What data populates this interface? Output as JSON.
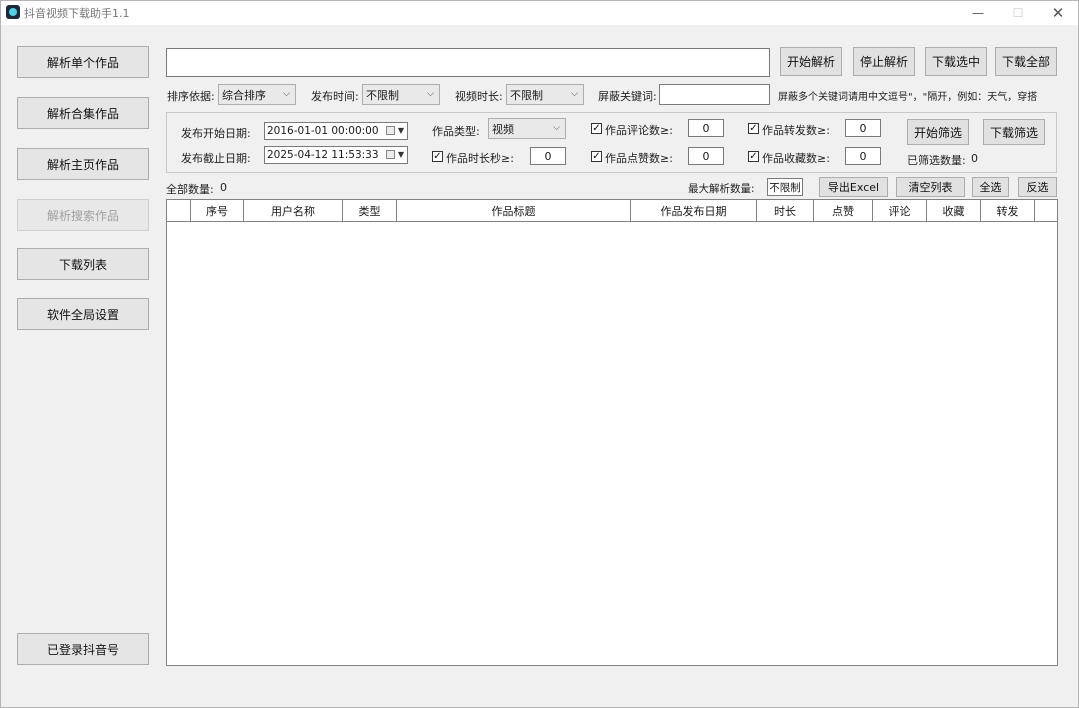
{
  "window": {
    "title": "抖音视频下载助手1.1",
    "min_glyph": "—",
    "max_glyph": "☐",
    "close_glyph": "✕"
  },
  "nav": {
    "parse_single": "解析单个作品",
    "parse_collection": "解析合集作品",
    "parse_homepage": "解析主页作品",
    "parse_search": "解析搜索作品",
    "download_list": "下载列表",
    "global_settings": "软件全局设置",
    "logged_in_account": "已登录抖音号"
  },
  "toolbar": {
    "url_value": "",
    "start_parse": "开始解析",
    "stop_parse": "停止解析",
    "download_selected": "下载选中",
    "download_all": "下载全部"
  },
  "sort_row": {
    "sort_label": "排序依据:",
    "sort_value": "综合排序",
    "publish_time_label": "发布时间:",
    "publish_time_value": "不限制",
    "duration_label": "视频时长:",
    "duration_value": "不限制",
    "block_keyword_label": "屏蔽关键词:",
    "block_keyword_value": "",
    "block_hint": "屏蔽多个关键词请用中文逗号\"，\"隔开，例如：天气，穿搭"
  },
  "filter": {
    "start_date_label": "发布开始日期:",
    "start_date_value": "2016-01-01 00:00:00",
    "end_date_label": "发布截止日期:",
    "end_date_value": "2025-04-12 11:53:33",
    "type_label": "作品类型:",
    "type_value": "视频",
    "duration_sec_label": "作品时长秒≥:",
    "duration_sec_value": "0",
    "comments_label": "作品评论数≥:",
    "comments_value": "0",
    "likes_label": "作品点赞数≥:",
    "likes_value": "0",
    "shares_label": "作品转发数≥:",
    "shares_value": "0",
    "favorites_label": "作品收藏数≥:",
    "favorites_value": "0",
    "start_filter": "开始筛选",
    "download_filter": "下载筛选",
    "filtered_count_label": "已筛选数量:",
    "filtered_count_value": "0"
  },
  "list_bar": {
    "total_label": "全部数量:",
    "total_value": "0",
    "max_parse_label": "最大解析数量:",
    "max_parse_value": "不限制",
    "export_excel": "导出Excel",
    "clear_list": "清空列表",
    "select_all": "全选",
    "invert_select": "反选"
  },
  "table": {
    "columns": [
      "",
      "序号",
      "用户名称",
      "类型",
      "作品标题",
      "作品发布日期",
      "时长",
      "点赞",
      "评论",
      "收藏",
      "转发",
      ""
    ]
  },
  "check_glyph": "✓",
  "dropdown_glyph": "⌵"
}
